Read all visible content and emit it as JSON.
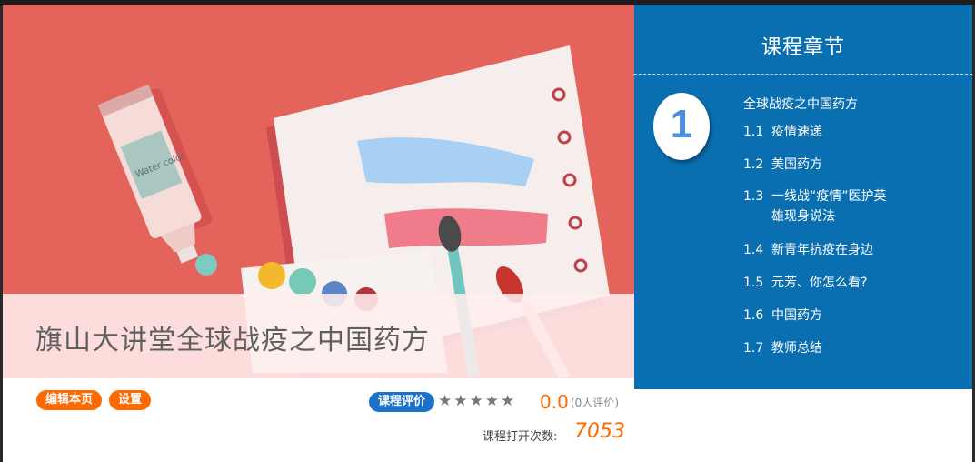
{
  "banner": {
    "title": "旗山大讲堂全球战疫之中国药方",
    "tube_label": "Water color"
  },
  "toolbar": {
    "edit_label": "编辑本页",
    "settings_label": "设置"
  },
  "rating": {
    "eval_label": "课程评价",
    "stars_filled": 0,
    "stars_total": 5,
    "score": "0.0",
    "count_text": "(0人评价)"
  },
  "stats": {
    "open_label": "课程打开次数:",
    "open_count": "7053"
  },
  "chapters": {
    "header": "课程章节",
    "number": "1",
    "name": "全球战疫之中国药方",
    "lessons": [
      {
        "num": "1.1",
        "title": "疫情速递"
      },
      {
        "num": "1.2",
        "title": "美国药方"
      },
      {
        "num": "1.3",
        "title": "一线战“疫情”医护英雄现身说法"
      },
      {
        "num": "1.4",
        "title": "新青年抗疫在身边"
      },
      {
        "num": "1.5",
        "title": "元芳、你怎么看?"
      },
      {
        "num": "1.6",
        "title": "中国药方"
      },
      {
        "num": "1.7",
        "title": "教师总结"
      }
    ]
  },
  "colors": {
    "banner_bg": "#e4635a",
    "panel_bg": "#0a6fb1",
    "accent_orange": "#ff6a00",
    "eval_blue": "#1c72c8"
  }
}
